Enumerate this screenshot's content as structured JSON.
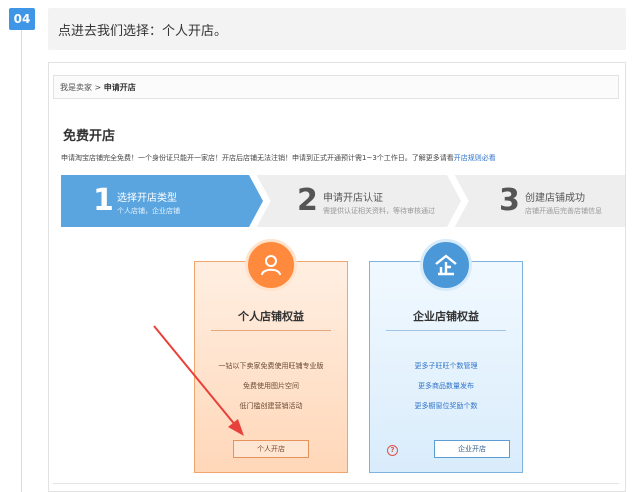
{
  "step": {
    "number": "04",
    "instruction": "点进去我们选择：个人开店。"
  },
  "breadcrumb": {
    "root": "我是卖家",
    "separator": " > ",
    "current": "申请开店"
  },
  "page_title": "免费开店",
  "notice": {
    "text": "申请淘宝店铺完全免费！一个身份证只能开一家店！开店后店铺无法注销！申请到正式开通预计需1~3个工作日。了解更多请看",
    "link": "开店规则必看"
  },
  "wizard": [
    {
      "num": "1",
      "title": "选择开店类型",
      "desc": "个人店铺，企业店铺"
    },
    {
      "num": "2",
      "title": "申请开店认证",
      "desc": "需提供认证相关资料，等待审核通过"
    },
    {
      "num": "3",
      "title": "创建店铺成功",
      "desc": "店铺开通后完善店铺信息"
    }
  ],
  "cards": {
    "personal": {
      "icon": "person-icon",
      "title": "个人店铺权益",
      "benefits": [
        "一钻以下卖家免费使用旺铺专业版",
        "免费使用图片空间",
        "低门槛创建营销活动"
      ],
      "button": "个人开店"
    },
    "company": {
      "icon": "enterprise-icon",
      "title": "企业店铺权益",
      "benefits": [
        "更多子旺旺个数管理",
        "更多商品数量发布",
        "更多橱窗位奖励个数"
      ],
      "button": "企业开店",
      "help": "?"
    }
  },
  "colors": {
    "step_tag": "#3f95e6",
    "wizard_active": "#5aa5e0",
    "wizard_inactive": "#eeeeee",
    "personal_accent": "#ff8a3d",
    "company_accent": "#4b98d8",
    "arrow": "#e8403a"
  }
}
